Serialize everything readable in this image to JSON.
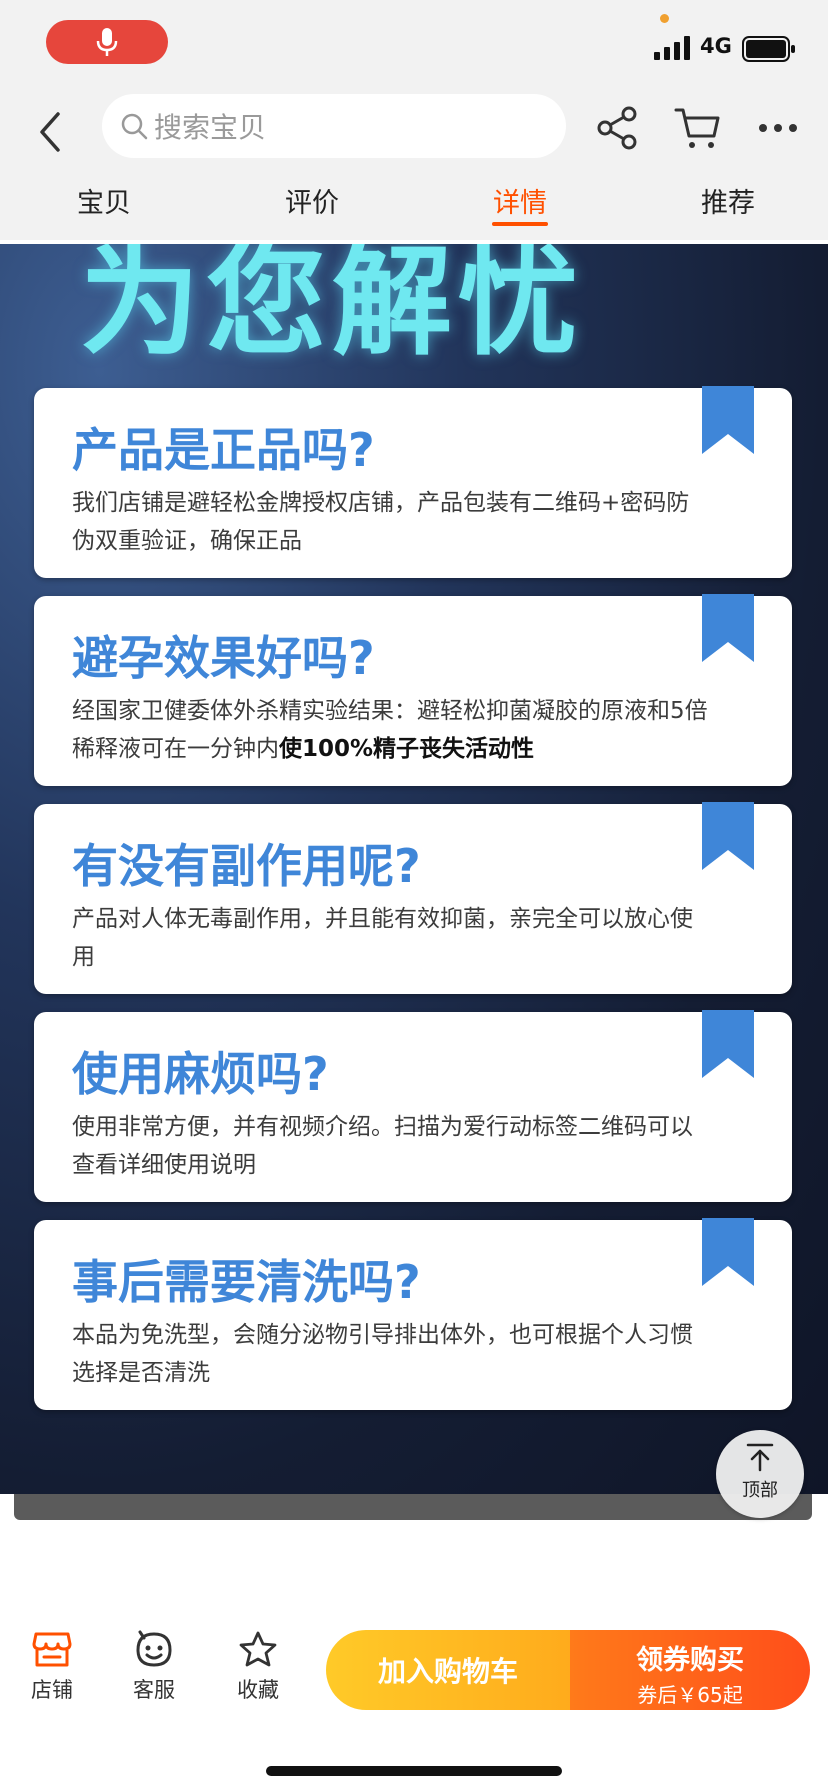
{
  "status_bar": {
    "network": "4G"
  },
  "nav": {
    "search_placeholder": "搜索宝贝",
    "tabs": [
      {
        "label": "宝贝",
        "active": false
      },
      {
        "label": "评价",
        "active": false
      },
      {
        "label": "详情",
        "active": true
      },
      {
        "label": "推荐",
        "active": false
      }
    ]
  },
  "banner": {
    "heading": "为您解忧",
    "faqs": [
      {
        "question": "产品是正品吗?",
        "answer": "我们店铺是避轻松金牌授权店铺，产品包装有二维码+密码防伪双重验证，确保正品",
        "answer_bold": ""
      },
      {
        "question": "避孕效果好吗?",
        "answer": "经国家卫健委体外杀精实验结果：避轻松抑菌凝胶的原液和5倍稀释液可在一分钟内",
        "answer_bold": "使100%精子丧失活动性"
      },
      {
        "question": "有没有副作用呢?",
        "answer": "产品对人体无毒副作用，并且能有效抑菌，亲完全可以放心使用",
        "answer_bold": ""
      },
      {
        "question": "使用麻烦吗?",
        "answer": "使用非常方便，并有视频介绍。扫描为爱行动标签二维码可以查看详细使用说明",
        "answer_bold": ""
      },
      {
        "question": "事后需要清洗吗?",
        "answer": "本品为免洗型，会随分泌物引导排出体外，也可根据个人习惯选择是否清洗",
        "answer_bold": ""
      }
    ]
  },
  "top_button": {
    "label": "顶部"
  },
  "bottom_bar": {
    "shop_label": "店铺",
    "service_label": "客服",
    "favorite_label": "收藏",
    "add_cart_label": "加入购物车",
    "buy_label": "领券购买",
    "buy_sub_label": "券后￥65起"
  },
  "colors": {
    "accent": "#ff5000",
    "question_blue": "#3f86d8",
    "heading_cyan": "#6fe8f0",
    "cart_button": "#ffb81f",
    "buy_button": "#ff5a1a",
    "mic_red": "#e6463c"
  }
}
